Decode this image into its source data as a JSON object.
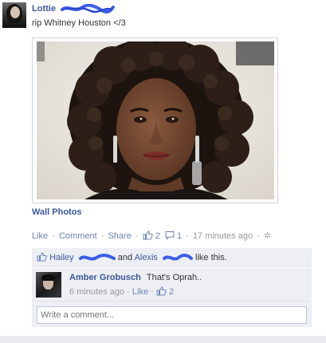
{
  "post": {
    "author": "Lottie",
    "status_text": "rip Whitney Houston </3",
    "photo_alt": "",
    "album_link": "Wall Photos",
    "actions": {
      "like": "Like",
      "comment": "Comment",
      "share": "Share",
      "likes_count": "2",
      "comments_count": "1",
      "timestamp": "17 minutes ago"
    },
    "likes_line": {
      "name1": "Hailey",
      "conj": "and",
      "name2": "Alexis",
      "suffix": "like this."
    },
    "comments": [
      {
        "author": "Amber Grobusch",
        "text": "That's Oprah..",
        "time": "6 minutes ago",
        "like": "Like",
        "likes_count": "2"
      }
    ],
    "write_comment_placeholder": "Write a comment..."
  },
  "colors": {
    "link_blue": "#3b5998",
    "action_blue": "#6d84b4",
    "scribble_blue": "#3b5ee8",
    "ufi_bg": "#edeff4"
  },
  "icons": {
    "like": "thumbs-up-icon",
    "comment": "comment-bubble-icon",
    "settings": "gear-icon"
  }
}
